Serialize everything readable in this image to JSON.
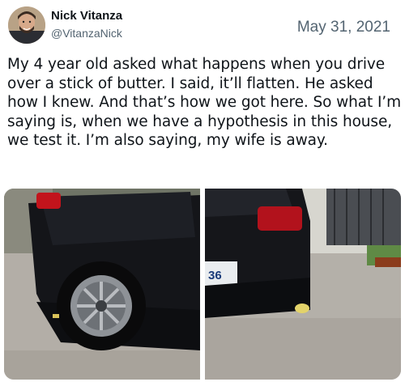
{
  "tweet": {
    "author_name": "Nick Vitanza",
    "author_handle": "@VitanzaNick",
    "date": "May 31, 2021",
    "text": "My 4 year old asked what happens when you drive over a stick of butter. I said, it’ll flatten. He asked how I knew. And that’s how we got here. So what I’m saying is, when we have a hypothesis in this house, we test it. I’m also saying, my wife is away."
  },
  "icons": {
    "avatar": "profile-photo-icon"
  },
  "colors": {
    "text": "#0f1419",
    "muted": "#536471",
    "background": "#ffffff"
  },
  "media": {
    "photo_count": 2,
    "right_photo_plate_text": "36"
  }
}
